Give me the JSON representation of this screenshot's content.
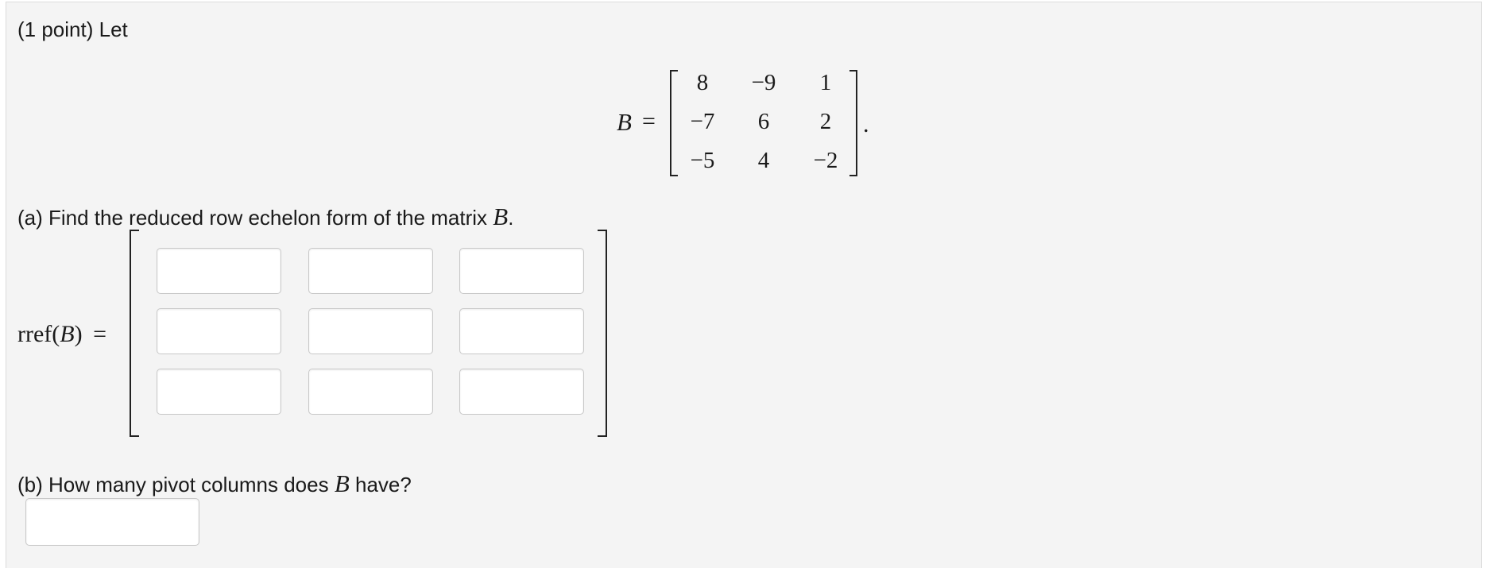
{
  "problem": {
    "intro": "(1 point) Let",
    "var_B": "B",
    "equals": "=",
    "period": ".",
    "matrix": [
      [
        "8",
        "−9",
        "1"
      ],
      [
        "−7",
        "6",
        "2"
      ],
      [
        "−5",
        "4",
        "−2"
      ]
    ]
  },
  "part_a": {
    "question_prefix": "(a) Find the reduced row echelon form of the matrix ",
    "question_var": "B",
    "question_suffix": ".",
    "rref_label": "rref(",
    "rref_var": "B",
    "rref_close": ")",
    "equals": "="
  },
  "part_b": {
    "question_prefix": "(b) How many pivot columns does ",
    "question_var": "B",
    "question_suffix": " have?"
  }
}
